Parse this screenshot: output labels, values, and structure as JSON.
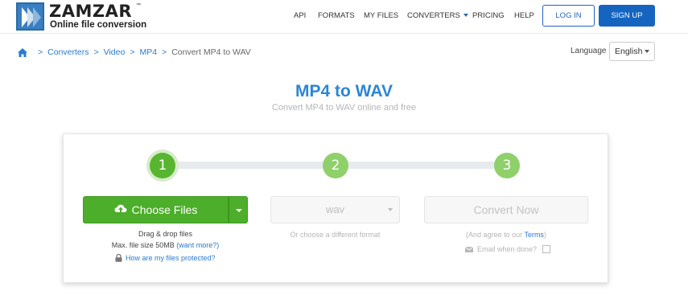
{
  "header": {
    "logo_name": "ZAMZAR",
    "logo_tm": "™",
    "logo_tagline": "Online file conversion",
    "nav": [
      {
        "label": "API"
      },
      {
        "label": "FORMATS"
      },
      {
        "label": "MY FILES"
      },
      {
        "label": "CONVERTERS"
      },
      {
        "label": "PRICING"
      },
      {
        "label": "HELP"
      }
    ],
    "login_label": "LOG IN",
    "signup_label": "SIGN UP"
  },
  "breadcrumb": {
    "items": [
      "Converters",
      "Video",
      "MP4"
    ],
    "current": "Convert MP4 to WAV",
    "separator": ">"
  },
  "language": {
    "label": "Language",
    "selected": "English"
  },
  "hero": {
    "title": "MP4 to WAV",
    "subtitle": "Convert MP4 to WAV online and free"
  },
  "steps": {
    "numbers": [
      "1",
      "2",
      "3"
    ],
    "active_color": "#58b530",
    "inactive_color": "#8fd06a"
  },
  "upload": {
    "choose_label": "Choose Files",
    "drag_text": "Drag & drop files",
    "max_size_text": "Max. file size 50MB",
    "want_more_text": "(want more?)",
    "protected_text": "How are my files protected?"
  },
  "format": {
    "selected": "wav",
    "hint": "Or choose a different format"
  },
  "convert": {
    "button_label": "Convert Now",
    "terms_prefix": "(And agree to our",
    "terms_link": "Terms",
    "terms_suffix": ")",
    "email_label": "Email when done?"
  },
  "colors": {
    "brand_blue": "#1565c0",
    "link_blue": "#2a7ad2",
    "title_blue": "#2b86d6",
    "green": "#4cae2a"
  }
}
